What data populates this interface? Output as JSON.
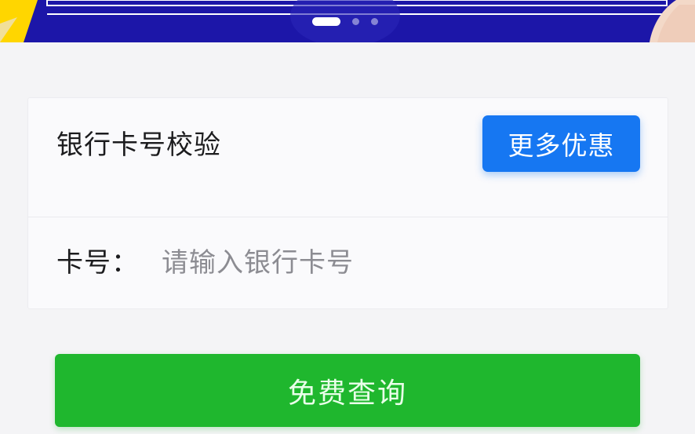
{
  "banner": {
    "slide_count": 3,
    "active_slide": 1,
    "colors": {
      "background": "#1c16a8",
      "accent": "#ffd600"
    }
  },
  "card": {
    "title": "银行卡号校验",
    "more_button_label": "更多优惠"
  },
  "form": {
    "card_number_label": "卡号：",
    "card_number_value": "",
    "card_number_placeholder": "请输入银行卡号"
  },
  "submit": {
    "label": "免费查询"
  },
  "colors": {
    "primary_blue": "#1677f2",
    "primary_green": "#1fb72e",
    "page_background": "#f4f4f6"
  }
}
